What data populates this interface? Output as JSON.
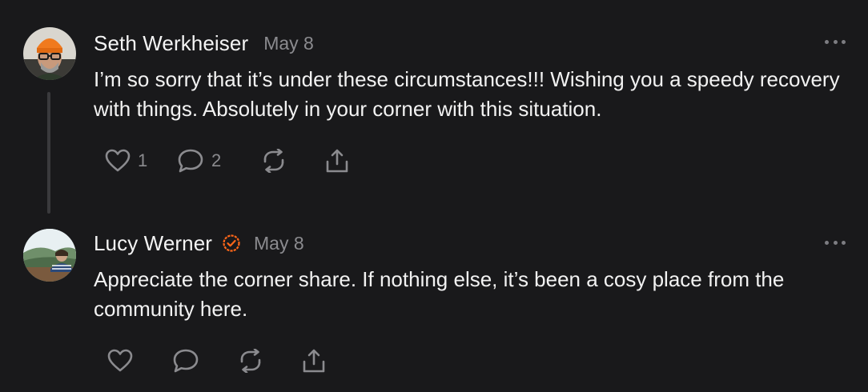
{
  "comments": [
    {
      "author": "Seth Werkheiser",
      "date": "May 8",
      "verified": false,
      "text": "I’m so sorry that it’s under these circumstances!!! Wishing you a speedy recovery with things. Absolutely in your corner with this situation.",
      "likes": "1",
      "replies": "2",
      "avatar_icon": "man-with-orange-beanie-avatar"
    },
    {
      "author": "Lucy Werner",
      "date": "May 8",
      "verified": true,
      "text": "Appreciate the corner share. If nothing else, it’s been a cosy place from the community here.",
      "likes": "",
      "replies": "",
      "avatar_icon": "woman-landscape-avatar"
    }
  ],
  "colors": {
    "background": "#19191b",
    "muted": "#8b8b8f",
    "verified": "#ff6719"
  },
  "icons": [
    "heart-icon",
    "comment-bubble-icon",
    "restack-icon",
    "share-icon",
    "more-options-icon",
    "verified-badge-icon"
  ]
}
